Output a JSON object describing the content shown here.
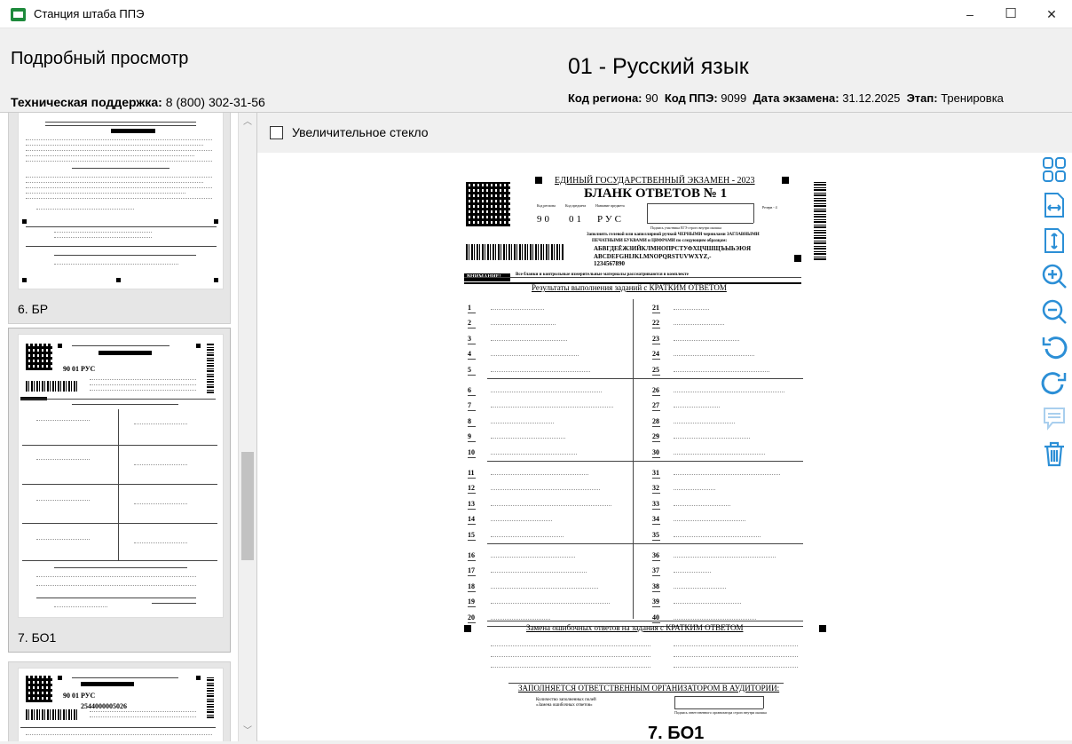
{
  "window": {
    "title": "Станция штаба ППЭ",
    "minimize": "–",
    "maximize": "☐",
    "close": "✕"
  },
  "header": {
    "detail_title": "Подробный просмотр",
    "support_label": "Техническая поддержка:",
    "support_phone": "8 (800) 302-31-56",
    "subject": "01 - Русский язык",
    "region_label": "Код региона:",
    "region_value": "90",
    "ppe_label": "Код ППЭ:",
    "ppe_value": "9099",
    "exam_date_label": "Дата экзамена:",
    "exam_date_value": "31.12.2025",
    "stage_label": "Этап:",
    "stage_value": "Тренировка"
  },
  "sidebar": {
    "thumbnails": [
      {
        "caption": "6. БР"
      },
      {
        "caption": "7. БО1"
      },
      {
        "caption": ""
      }
    ]
  },
  "main": {
    "magnifier_label": "Увеличительное стекло",
    "doc_caption": "7. БО1"
  },
  "document": {
    "exam_title": "ЕДИНЫЙ ГОСУДАРСТВЕННЫЙ ЭКЗАМЕН - 2023",
    "form_title": "БЛАНК ОТВЕТОВ № 1",
    "code_region_label": "Код региона",
    "code_subject_label": "Код предмета",
    "subject_name_label": "Название предмета",
    "reserve_label": "Резерв - 4",
    "region_value": "90",
    "subject_code_value": "01",
    "subject_name_value": "РУС",
    "signature_label": "Подпись участника ЕГЭ строго внутри окошка",
    "fill_instruction_1": "Заполнять гелевой или капиллярной ручкой ЧЕРНЫМИ чернилами ЗАГЛАВНЫМИ",
    "fill_instruction_2": "ПЕЧАТНЫМИ БУКВАМИ и ЦИФРАМИ по следующим образцам:",
    "sample_cyr": "АБВГДЕЁЖЗИЙКЛМНОПРСТУФХЦЧШЩЪЫЬЭЮЯ",
    "sample_lat": "ABCDEFGHIJKLMNOPQRSTUVWXYZ,-",
    "sample_digits": "1234567890",
    "attention_label": "ВНИМАНИЕ!",
    "attention_text": "Все бланки и контрольные измерительные материалы рассматриваются в комплекте",
    "short_answers_title": "Результаты выполнения заданий с КРАТКИМ ОТВЕТОМ",
    "left_numbers": [
      "1",
      "2",
      "3",
      "4",
      "5",
      "6",
      "7",
      "8",
      "9",
      "10",
      "11",
      "12",
      "13",
      "14",
      "15",
      "16",
      "17",
      "18",
      "19",
      "20"
    ],
    "right_numbers": [
      "21",
      "22",
      "23",
      "24",
      "25",
      "26",
      "27",
      "28",
      "29",
      "30",
      "31",
      "32",
      "33",
      "34",
      "35",
      "36",
      "37",
      "38",
      "39",
      "40"
    ],
    "replacement_title": "Замена ошибочных ответов на задания с КРАТКИМ ОТВЕТОМ",
    "organizer_title": "ЗАПОЛНЯЕТСЯ ОТВЕТСТВЕННЫМ ОРГАНИЗАТОРОМ В АУДИТОРИИ:",
    "count_label_1": "Количество заполненных полей",
    "count_label_2": "«Замена ошибочных ответов»",
    "organizer_sign": "Подпись ответственного организатора строго внутри окошка"
  },
  "tools": [
    {
      "icon": "thumbnails-grid-icon"
    },
    {
      "icon": "fit-width-icon"
    },
    {
      "icon": "fit-height-icon"
    },
    {
      "icon": "zoom-in-icon"
    },
    {
      "icon": "zoom-out-icon"
    },
    {
      "icon": "rotate-left-icon"
    },
    {
      "icon": "rotate-right-icon"
    },
    {
      "icon": "comment-icon"
    },
    {
      "icon": "delete-icon"
    }
  ],
  "colors": {
    "accent": "#2c8fd6",
    "app_icon": "#1e8a3c",
    "disabled_tool": "#a9cfee"
  }
}
